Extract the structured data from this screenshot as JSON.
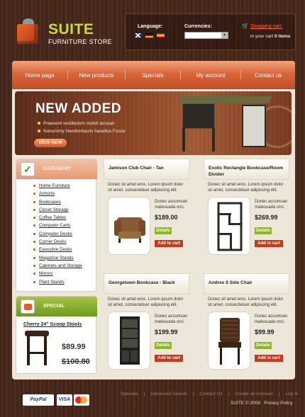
{
  "header": {
    "logo_title": "SUITE",
    "logo_subtitle": "FURNITURE STORE",
    "language_label": "Language:",
    "languages": [
      "en-flag-icon",
      "de-flag-icon",
      "es-flag-icon"
    ],
    "currencies_label": "Currencies:",
    "currencies_value": "",
    "cart_label": "Shopping cart:",
    "cart_info_prefix": "in your cart",
    "cart_count": "0 items"
  },
  "nav": {
    "items": [
      "Home page",
      "New products",
      "Specials",
      "My account",
      "Contact us"
    ]
  },
  "banner": {
    "title": "NEW ADDED",
    "bullets": [
      "Praesent vestibulum molsti acusan",
      "Nonummy Hendrerlauris haselius Fusce"
    ],
    "button": "click here"
  },
  "sidebar": {
    "category_label": "CATEGORY",
    "categories": [
      "Home Furniture",
      "Armoire",
      "Bookcases",
      "Closet Storage",
      "Coffee Tables",
      "Computer Carts",
      "Computer Desks",
      "Corner Desks",
      "Executive Desks",
      "Magazine Stands",
      "Cabinets and Storage",
      "Mirrors",
      "Plant Stands"
    ],
    "special_label": "SPECIAL",
    "special_title": "Cherry 24\" Scoop Stools",
    "special_price": "$89.99",
    "special_old_price": "$100.80"
  },
  "products": [
    {
      "name": "Jamison Club Chair - Tan",
      "desc": "Donec sit amet eros. Lorem ipsum dolor sit amet, consectetuer adipiscing elit.",
      "mini": "Donec accumsan malesuada orci.",
      "price": "$189.00",
      "details": "Details",
      "add": "Add to cart"
    },
    {
      "name": "Exotic Rectangle Bookcase/Room Divider",
      "desc": "Donec sit amet eros. Lorem ipsum dolor sit amet, consectetuer adipiscing elit.",
      "mini": "Donec accumsan malesuada orci.",
      "price": "$269.99",
      "details": "Details",
      "add": "Add to cart"
    },
    {
      "name": "Georgetown Bookcase - Black",
      "desc": "Donec sit amet eros. Lorem ipsum dolor sit amet, consectetuer adipiscing elit.",
      "mini": "Donec accumsan malesuada orci.",
      "price": "$199.99",
      "details": "Details",
      "add": "Add to cart"
    },
    {
      "name": "Andres II Side Chair",
      "desc": "Donec sit amet eros. Lorem ipsum dolor sit amet, consectetuer adipiscing elit.",
      "mini": "Donec accumsan malesuada orci.",
      "price": "$99.99",
      "details": "Details",
      "add": "Add to cart"
    }
  ],
  "footer": {
    "links": [
      "Specials",
      "Advanced Search",
      "Contact Us",
      "Create an Account",
      "Log In"
    ],
    "copyright": "SUITE © 2008",
    "privacy": "Privacy Policy",
    "payments": {
      "paypal": "PayPal",
      "visa": "VISA"
    }
  },
  "colors": {
    "accent": "#d8663a",
    "logo_green": "#c6dc3c",
    "button_green": "#8bb81e",
    "button_red": "#c83a1a"
  }
}
